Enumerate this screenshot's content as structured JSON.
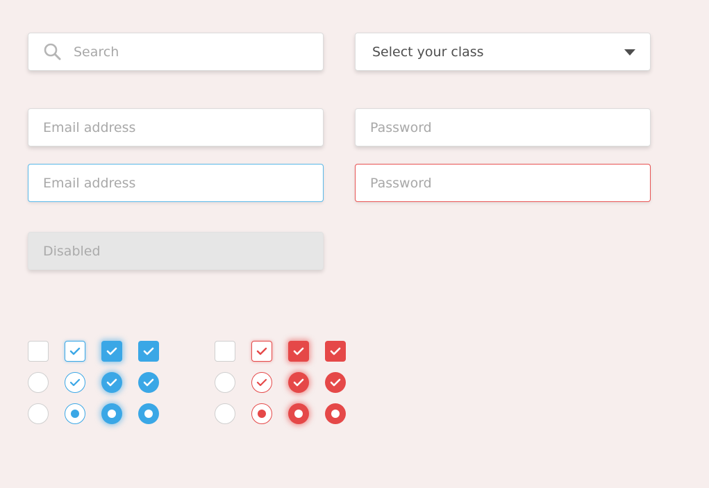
{
  "form": {
    "search": {
      "placeholder": "Search",
      "icon": "search-icon"
    },
    "class_select": {
      "value": "Select your class",
      "icon": "caret-down-icon"
    },
    "email_default": {
      "placeholder": "Email address"
    },
    "password_default": {
      "placeholder": "Password"
    },
    "email_focused": {
      "placeholder": "Email address",
      "state": "focused"
    },
    "password_error": {
      "placeholder": "Password",
      "state": "error"
    },
    "disabled_input": {
      "placeholder": "Disabled",
      "state": "disabled"
    }
  },
  "colors": {
    "background": "#f7eeed",
    "accent_blue": "#3aa7e6",
    "accent_red": "#e54848",
    "placeholder_text": "#a8a8a8",
    "disabled_bg": "#e6e6e6"
  },
  "controls": {
    "blue_group": {
      "checkboxes": [
        "unchecked",
        "checked-outline",
        "checked-focus",
        "checked"
      ],
      "circle_checks": [
        "unchecked",
        "checked-outline",
        "checked-focus",
        "checked"
      ],
      "radios": [
        "unselected",
        "selected-outline",
        "selected-focus",
        "selected"
      ]
    },
    "red_group": {
      "checkboxes": [
        "unchecked",
        "checked-outline",
        "checked-focus",
        "checked"
      ],
      "circle_checks": [
        "unchecked",
        "checked-outline",
        "checked-focus",
        "checked"
      ],
      "radios": [
        "unselected",
        "selected-outline",
        "selected-focus",
        "selected"
      ]
    }
  }
}
